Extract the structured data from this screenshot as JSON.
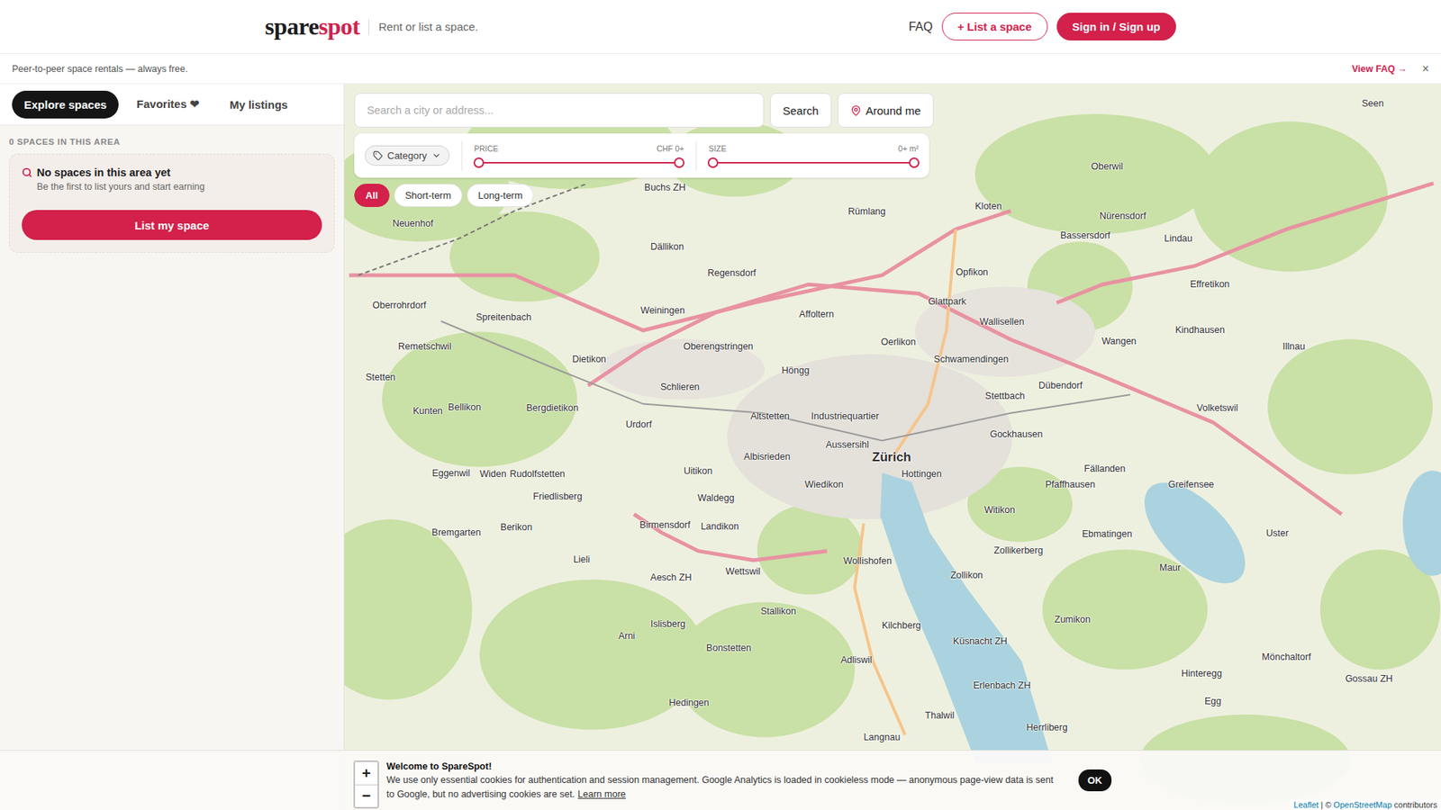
{
  "header": {
    "logo": {
      "first": "spare",
      "second": "spot"
    },
    "tagline": "Rent or list a space.",
    "nav": [
      "FAQ"
    ],
    "list_button": "+ List a space",
    "sign_button": "Sign in / Sign up"
  },
  "banner": {
    "text": "Peer-to-peer space rentals — always free.",
    "link": "View FAQ →",
    "close": "×"
  },
  "sidebar": {
    "tabs": [
      {
        "label": "Explore spaces",
        "selected": true
      },
      {
        "label": "Favorites ❤",
        "selected": false
      },
      {
        "label": "My listings",
        "selected": false
      }
    ],
    "count": "0 SPACES IN THIS AREA",
    "empty": {
      "title": "No spaces in this area yet",
      "subtitle": "Be the first to list yours and start earning",
      "button": "List my space"
    }
  },
  "map": {
    "search": {
      "placeholder": "Search a city or address...",
      "button": "Search",
      "around": "Around me"
    },
    "category": "Category",
    "sliders": [
      {
        "label": "PRICE",
        "reading": "CHF 0+",
        "level": 1
      },
      {
        "label": "SIZE",
        "reading": "0+ m²",
        "level": 1
      }
    ],
    "chips": [
      {
        "label": "All",
        "selected": true
      },
      {
        "label": "Short-term",
        "selected": false
      },
      {
        "label": "Long-term",
        "selected": false
      }
    ],
    "zoom": [
      "+",
      "−"
    ],
    "attribution": {
      "leaflet": "Leaflet",
      "separator": "| ©",
      "osm": "OpenStreetMap",
      "suffix": "contributors"
    },
    "places": [
      "Kloten",
      "Bassersdorf",
      "Opfikon",
      "Wallisellen",
      "Regensdorf",
      "Spreitenbach",
      "Dietikon",
      "Schlieren",
      "Höngg",
      "Oerlikon",
      "Dübendorf",
      "Volketswil",
      "Effretikon",
      "Illnau",
      "Zürich",
      "Altstetten",
      "Industriequartier",
      "Aussersihl",
      "Hottingen",
      "Wiedikon",
      "Albisrieden",
      "Uitikon",
      "Waldegg",
      "Birmensdorf",
      "Bremgarten",
      "Wollishofen",
      "Zollikon",
      "Küsnacht ZH",
      "Adliswil",
      "Thalwil",
      "Uster",
      "Greifensee",
      "Zollikerberg",
      "Bergdietikon",
      "Urdorf",
      "Kilchberg",
      "Langnau",
      "Hedingen",
      "Affoltern",
      "Glattpark",
      "Schwamendingen",
      "Witikon",
      "Gockhausen",
      "Fällanden",
      "Maur",
      "Egg",
      "Gossau ZH",
      "Seen",
      "Buchs ZH",
      "Dällikon",
      "Weiningen",
      "Stettbach",
      "Wangen",
      "Rümlang",
      "Nürensdorf",
      "Lindau",
      "Pfaffhausen",
      "Ebmatingen",
      "Zumikon",
      "Mönchaltorf",
      "Oberwil",
      "Rudolfstetten",
      "Friedlisberg",
      "Oberengstringen",
      "Landikon",
      "Wettswil",
      "Stallikon",
      "Bonstetten",
      "Islisberg",
      "Arni",
      "Lieli",
      "Aesch ZH",
      "Berikon",
      "Widen",
      "Eggenwil",
      "Erlenbach ZH",
      "Herrliberg",
      "Hinteregg",
      "Kindhausen",
      "Kunten",
      "Bellikon",
      "Stetten",
      "Remetschwil",
      "Neuenhof",
      "Oberrohrdorf"
    ]
  },
  "cookie": {
    "title": "Welcome to SpareSpot!",
    "text": "We use only essential cookies for authentication and session management. Google Analytics is loaded in cookieless mode — anonymous page-view data is sent to Google, but no advertising cookies are set.",
    "link": "Learn more",
    "button": "OK"
  }
}
